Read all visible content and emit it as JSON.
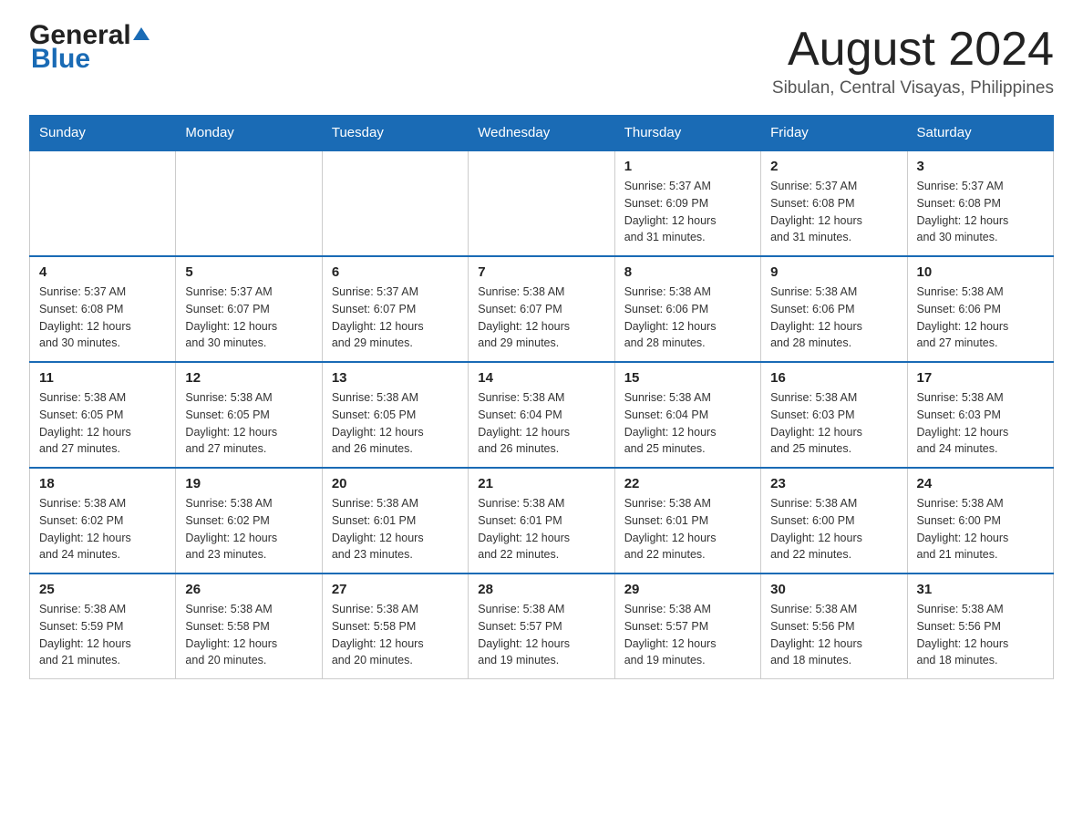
{
  "header": {
    "logo_main": "General",
    "logo_blue": "Blue",
    "month_title": "August 2024",
    "location": "Sibulan, Central Visayas, Philippines"
  },
  "calendar": {
    "days_of_week": [
      "Sunday",
      "Monday",
      "Tuesday",
      "Wednesday",
      "Thursday",
      "Friday",
      "Saturday"
    ],
    "weeks": [
      [
        {
          "day": "",
          "info": ""
        },
        {
          "day": "",
          "info": ""
        },
        {
          "day": "",
          "info": ""
        },
        {
          "day": "",
          "info": ""
        },
        {
          "day": "1",
          "info": "Sunrise: 5:37 AM\nSunset: 6:09 PM\nDaylight: 12 hours\nand 31 minutes."
        },
        {
          "day": "2",
          "info": "Sunrise: 5:37 AM\nSunset: 6:08 PM\nDaylight: 12 hours\nand 31 minutes."
        },
        {
          "day": "3",
          "info": "Sunrise: 5:37 AM\nSunset: 6:08 PM\nDaylight: 12 hours\nand 30 minutes."
        }
      ],
      [
        {
          "day": "4",
          "info": "Sunrise: 5:37 AM\nSunset: 6:08 PM\nDaylight: 12 hours\nand 30 minutes."
        },
        {
          "day": "5",
          "info": "Sunrise: 5:37 AM\nSunset: 6:07 PM\nDaylight: 12 hours\nand 30 minutes."
        },
        {
          "day": "6",
          "info": "Sunrise: 5:37 AM\nSunset: 6:07 PM\nDaylight: 12 hours\nand 29 minutes."
        },
        {
          "day": "7",
          "info": "Sunrise: 5:38 AM\nSunset: 6:07 PM\nDaylight: 12 hours\nand 29 minutes."
        },
        {
          "day": "8",
          "info": "Sunrise: 5:38 AM\nSunset: 6:06 PM\nDaylight: 12 hours\nand 28 minutes."
        },
        {
          "day": "9",
          "info": "Sunrise: 5:38 AM\nSunset: 6:06 PM\nDaylight: 12 hours\nand 28 minutes."
        },
        {
          "day": "10",
          "info": "Sunrise: 5:38 AM\nSunset: 6:06 PM\nDaylight: 12 hours\nand 27 minutes."
        }
      ],
      [
        {
          "day": "11",
          "info": "Sunrise: 5:38 AM\nSunset: 6:05 PM\nDaylight: 12 hours\nand 27 minutes."
        },
        {
          "day": "12",
          "info": "Sunrise: 5:38 AM\nSunset: 6:05 PM\nDaylight: 12 hours\nand 27 minutes."
        },
        {
          "day": "13",
          "info": "Sunrise: 5:38 AM\nSunset: 6:05 PM\nDaylight: 12 hours\nand 26 minutes."
        },
        {
          "day": "14",
          "info": "Sunrise: 5:38 AM\nSunset: 6:04 PM\nDaylight: 12 hours\nand 26 minutes."
        },
        {
          "day": "15",
          "info": "Sunrise: 5:38 AM\nSunset: 6:04 PM\nDaylight: 12 hours\nand 25 minutes."
        },
        {
          "day": "16",
          "info": "Sunrise: 5:38 AM\nSunset: 6:03 PM\nDaylight: 12 hours\nand 25 minutes."
        },
        {
          "day": "17",
          "info": "Sunrise: 5:38 AM\nSunset: 6:03 PM\nDaylight: 12 hours\nand 24 minutes."
        }
      ],
      [
        {
          "day": "18",
          "info": "Sunrise: 5:38 AM\nSunset: 6:02 PM\nDaylight: 12 hours\nand 24 minutes."
        },
        {
          "day": "19",
          "info": "Sunrise: 5:38 AM\nSunset: 6:02 PM\nDaylight: 12 hours\nand 23 minutes."
        },
        {
          "day": "20",
          "info": "Sunrise: 5:38 AM\nSunset: 6:01 PM\nDaylight: 12 hours\nand 23 minutes."
        },
        {
          "day": "21",
          "info": "Sunrise: 5:38 AM\nSunset: 6:01 PM\nDaylight: 12 hours\nand 22 minutes."
        },
        {
          "day": "22",
          "info": "Sunrise: 5:38 AM\nSunset: 6:01 PM\nDaylight: 12 hours\nand 22 minutes."
        },
        {
          "day": "23",
          "info": "Sunrise: 5:38 AM\nSunset: 6:00 PM\nDaylight: 12 hours\nand 22 minutes."
        },
        {
          "day": "24",
          "info": "Sunrise: 5:38 AM\nSunset: 6:00 PM\nDaylight: 12 hours\nand 21 minutes."
        }
      ],
      [
        {
          "day": "25",
          "info": "Sunrise: 5:38 AM\nSunset: 5:59 PM\nDaylight: 12 hours\nand 21 minutes."
        },
        {
          "day": "26",
          "info": "Sunrise: 5:38 AM\nSunset: 5:58 PM\nDaylight: 12 hours\nand 20 minutes."
        },
        {
          "day": "27",
          "info": "Sunrise: 5:38 AM\nSunset: 5:58 PM\nDaylight: 12 hours\nand 20 minutes."
        },
        {
          "day": "28",
          "info": "Sunrise: 5:38 AM\nSunset: 5:57 PM\nDaylight: 12 hours\nand 19 minutes."
        },
        {
          "day": "29",
          "info": "Sunrise: 5:38 AM\nSunset: 5:57 PM\nDaylight: 12 hours\nand 19 minutes."
        },
        {
          "day": "30",
          "info": "Sunrise: 5:38 AM\nSunset: 5:56 PM\nDaylight: 12 hours\nand 18 minutes."
        },
        {
          "day": "31",
          "info": "Sunrise: 5:38 AM\nSunset: 5:56 PM\nDaylight: 12 hours\nand 18 minutes."
        }
      ]
    ]
  }
}
